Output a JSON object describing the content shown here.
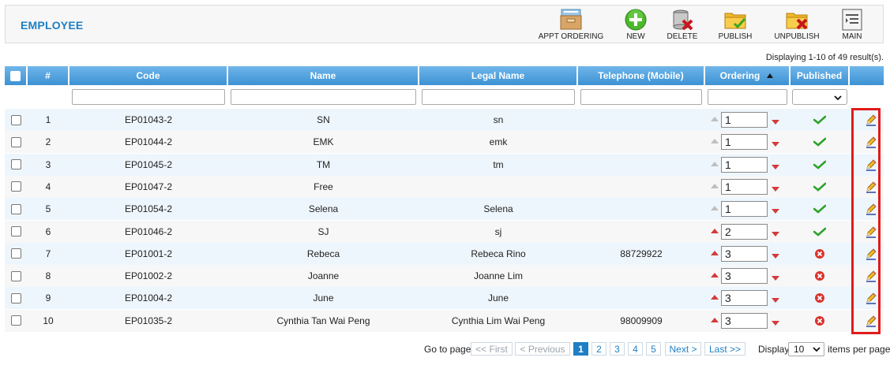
{
  "header": {
    "title": "EMPLOYEE",
    "toolbar": [
      {
        "label": "APPT ORDERING",
        "icon": "appt-ordering-icon"
      },
      {
        "label": "NEW",
        "icon": "new-plus-icon"
      },
      {
        "label": "DELETE",
        "icon": "delete-database-icon"
      },
      {
        "label": "PUBLISH",
        "icon": "publish-folder-icon"
      },
      {
        "label": "UNPUBLISH",
        "icon": "unpublish-folder-icon"
      },
      {
        "label": "MAIN",
        "icon": "main-menu-icon"
      }
    ]
  },
  "result_info": "Displaying 1-10 of 49 result(s).",
  "table": {
    "columns": [
      "#",
      "Code",
      "Name",
      "Legal Name",
      "Telephone (Mobile)",
      "Ordering",
      "Published"
    ],
    "rows": [
      {
        "num": "1",
        "code": "EP01043-2",
        "name": "SN",
        "legal": "sn",
        "tel": "",
        "order": "1",
        "up_active": false,
        "published": true
      },
      {
        "num": "2",
        "code": "EP01044-2",
        "name": "EMK",
        "legal": "emk",
        "tel": "",
        "order": "1",
        "up_active": false,
        "published": true
      },
      {
        "num": "3",
        "code": "EP01045-2",
        "name": "TM",
        "legal": "tm",
        "tel": "",
        "order": "1",
        "up_active": false,
        "published": true
      },
      {
        "num": "4",
        "code": "EP01047-2",
        "name": "Free",
        "legal": "",
        "tel": "",
        "order": "1",
        "up_active": false,
        "published": true
      },
      {
        "num": "5",
        "code": "EP01054-2",
        "name": "Selena",
        "legal": "Selena",
        "tel": "",
        "order": "1",
        "up_active": false,
        "published": true
      },
      {
        "num": "6",
        "code": "EP01046-2",
        "name": "SJ",
        "legal": "sj",
        "tel": "",
        "order": "2",
        "up_active": true,
        "published": true
      },
      {
        "num": "7",
        "code": "EP01001-2",
        "name": "Rebeca",
        "legal": "Rebeca Rino",
        "tel": "88729922",
        "order": "3",
        "up_active": true,
        "published": false
      },
      {
        "num": "8",
        "code": "EP01002-2",
        "name": "Joanne",
        "legal": "Joanne Lim",
        "tel": "",
        "order": "3",
        "up_active": true,
        "published": false
      },
      {
        "num": "9",
        "code": "EP01004-2",
        "name": "June",
        "legal": "June",
        "tel": "",
        "order": "3",
        "up_active": true,
        "published": false
      },
      {
        "num": "10",
        "code": "EP01035-2",
        "name": "Cynthia Tan Wai Peng",
        "legal": "Cynthia Lim Wai Peng",
        "tel": "98009909",
        "order": "3",
        "up_active": true,
        "published": false
      }
    ]
  },
  "pagination": {
    "goto_label": "Go to page:",
    "first": "<< First",
    "previous": "< Previous",
    "pages": [
      "1",
      "2",
      "3",
      "4",
      "5"
    ],
    "current": "1",
    "next": "Next >",
    "last": "Last >>",
    "display_label": "Display",
    "per_page": "10",
    "per_page_suffix": "items per page"
  },
  "colors": {
    "title": "#1e7fc4",
    "header_grad_top": "#6fb6ea",
    "header_grad_bottom": "#3d92d4",
    "highlight_border": "#e01b1b"
  }
}
